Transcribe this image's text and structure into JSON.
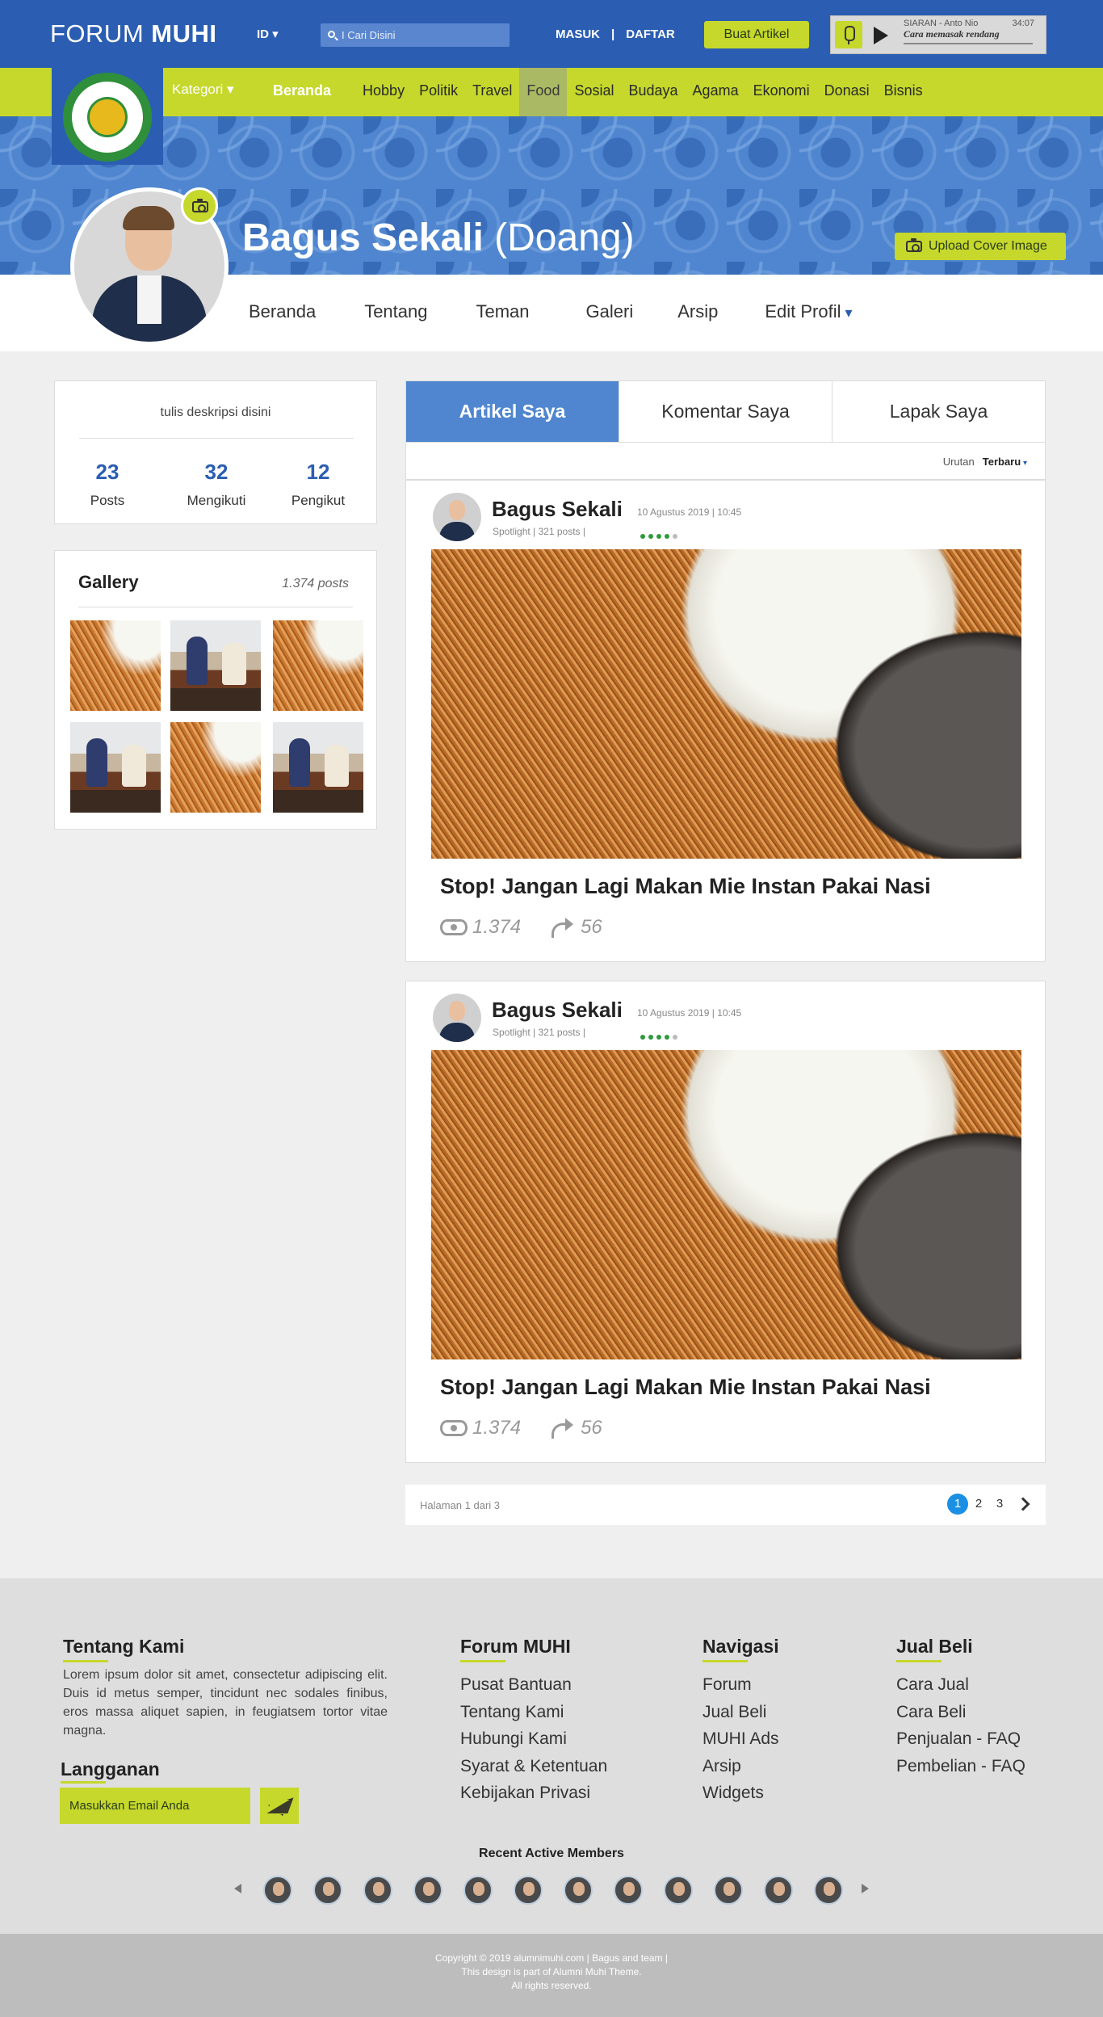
{
  "header": {
    "brand_light": "FORUM",
    "brand_bold": "MUHI",
    "lang": "ID ▾",
    "search_placeholder": "I Cari Disini",
    "login": "MASUK",
    "separator": "|",
    "register": "DAFTAR",
    "create_article": "Buat Artikel",
    "radio": {
      "label": "SIARAN  -  Anto Nio",
      "time": "34:07",
      "title": "Cara memasak rendang"
    }
  },
  "nav": {
    "kategori": "Kategori ▾",
    "links": [
      "Beranda",
      "Hobby",
      "Politik",
      "Travel",
      "Food",
      "Sosial",
      "Budaya",
      "Agama",
      "Ekonomi",
      "Donasi",
      "Bisnis"
    ],
    "active": "Food"
  },
  "profile": {
    "name": "Bagus Sekali",
    "alias": "(Doang)",
    "upload_cover": "Upload Cover Image",
    "tabs": [
      "Beranda",
      "Tentang",
      "Teman",
      "Galeri",
      "Arsip",
      "Edit Profil"
    ]
  },
  "sidebar": {
    "description": "tulis deskripsi disini",
    "stats": [
      {
        "value": "23",
        "label": "Posts"
      },
      {
        "value": "32",
        "label": "Mengikuti"
      },
      {
        "value": "12",
        "label": "Pengikut"
      }
    ],
    "gallery_title": "Gallery",
    "gallery_count": "1.374 posts"
  },
  "main": {
    "tabs": [
      "Artikel Saya",
      "Komentar Saya",
      "Lapak Saya"
    ],
    "sort_label": "Urutan",
    "sort_value": "Terbaru",
    "posts": [
      {
        "author": "Bagus Sekali",
        "date": "10 Agustus 2019   |   10:45",
        "sub": "Spotlight    |    321 posts    |",
        "rating": 4,
        "title": "Stop! Jangan Lagi Makan Mie Instan Pakai Nasi",
        "views": "1.374",
        "shares": "56"
      },
      {
        "author": "Bagus Sekali",
        "date": "10 Agustus 2019   |   10:45",
        "sub": "Spotlight    |    321 posts    |",
        "rating": 4,
        "title": "Stop! Jangan Lagi Makan Mie Instan Pakai Nasi",
        "views": "1.374",
        "shares": "56"
      }
    ],
    "pager_label": "Halaman 1 dari 3",
    "pages": [
      "1",
      "2",
      "3"
    ],
    "current_page": "1"
  },
  "footer": {
    "about_title": "Tentang Kami",
    "about_text": "Lorem ipsum dolor sit amet, consectetur adipiscing elit. Duis id metus semper, tincidunt nec sodales finibus, eros massa aliquet sapien, in feugiatsem tortor vitae magna.",
    "subscribe_title": "Langganan",
    "email_placeholder": "Masukkan Email Anda",
    "columns": [
      {
        "title": "Forum MUHI",
        "links": [
          "Pusat Bantuan",
          "Tentang Kami",
          "Hubungi Kami",
          "Syarat & Ketentuan",
          "Kebijakan Privasi"
        ]
      },
      {
        "title": "Navigasi",
        "links": [
          "Forum",
          "Jual Beli",
          "MUHI Ads",
          "Arsip",
          "Widgets"
        ]
      },
      {
        "title": "Jual Beli",
        "links": [
          "Cara Jual",
          "Cara Beli",
          "Penjualan - FAQ",
          "Pembelian - FAQ"
        ]
      }
    ],
    "recent_members_title": "Recent Active Members",
    "copyright_lines": [
      "Copyright © 2019 alumnimuhi.com | Bagus and team |",
      "This design is part of Alumni Muhi Theme.",
      "All rights reserved."
    ]
  },
  "colors": {
    "primary_blue": "#2b5eb2",
    "accent_green": "#c5d82b",
    "tab_blue": "#4f86cf",
    "page_active": "#1a8fe3"
  }
}
